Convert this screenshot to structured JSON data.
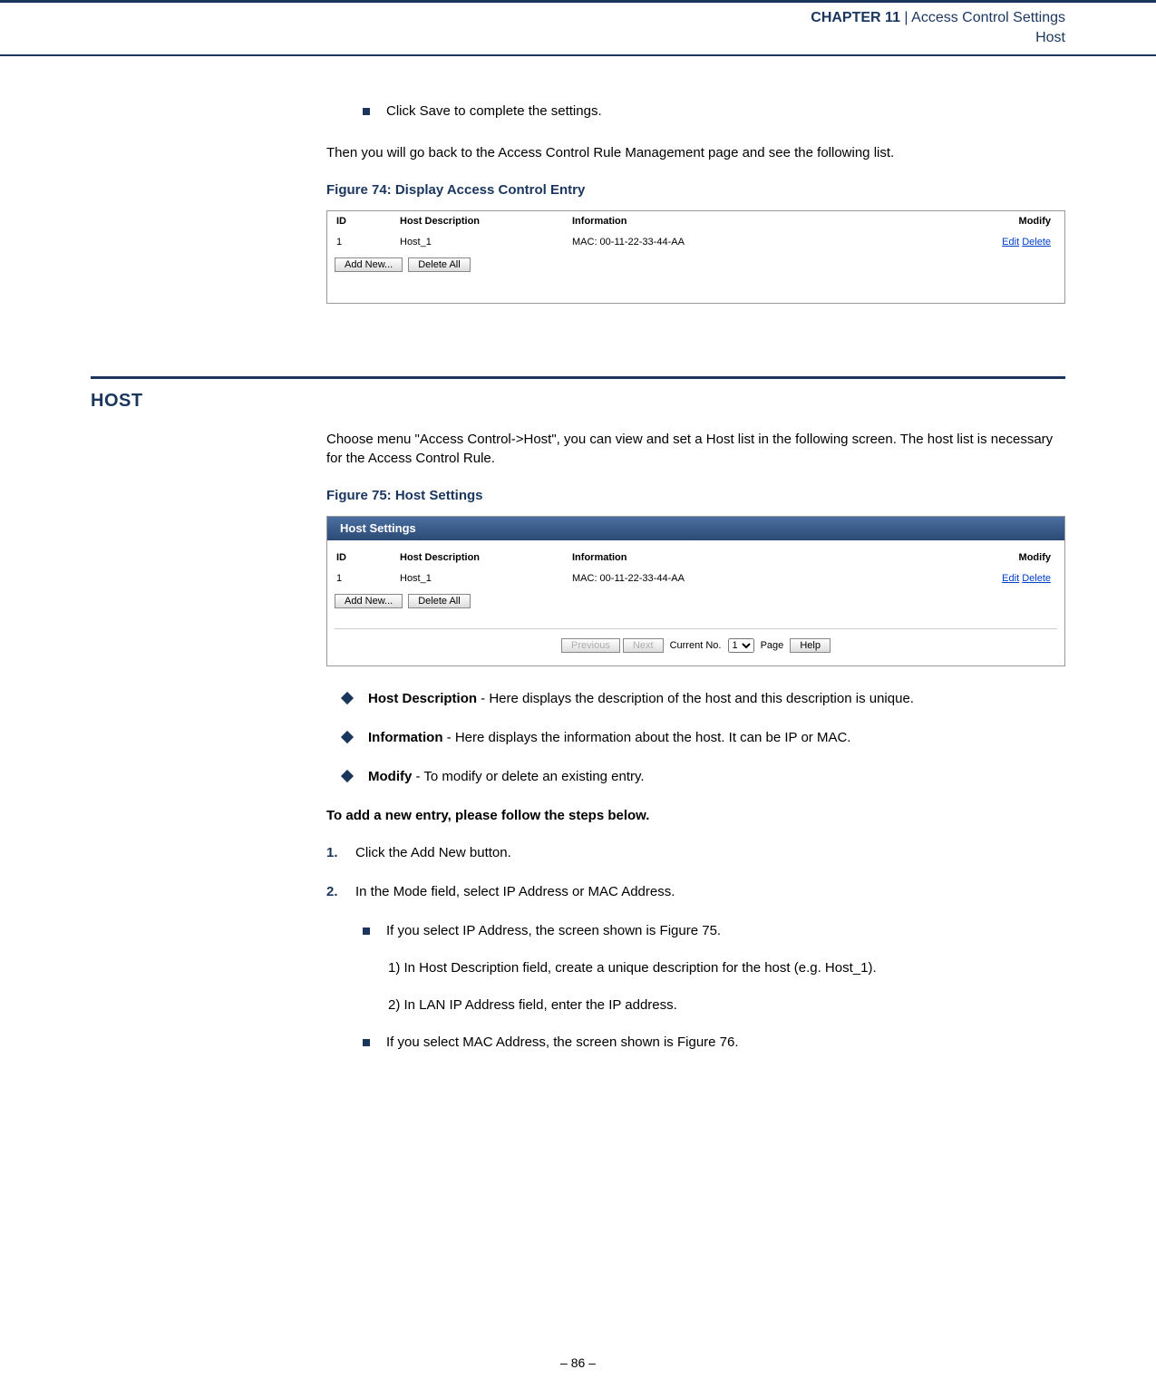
{
  "header": {
    "chapter_label": "CHAPTER 11",
    "separator": "  |  ",
    "title": "Access Control Settings",
    "subtitle": "Host"
  },
  "intro_bullet": "Click Save to complete the settings.",
  "intro_para": "Then you will go back to the Access Control Rule Management page and see the following list.",
  "fig74_caption": "Figure 74:  Display Access Control Entry",
  "fig74": {
    "cols": {
      "id": "ID",
      "desc": "Host Description",
      "info": "Information",
      "modify": "Modify"
    },
    "row": {
      "id": "1",
      "desc": "Host_1",
      "info": "MAC: 00-11-22-33-44-AA",
      "edit": "Edit",
      "delete": "Delete"
    },
    "btn_add": "Add New...",
    "btn_delall": "Delete All"
  },
  "section_heading": "HOST",
  "host_para": "Choose menu \"Access Control->Host\", you can view and set a Host list in the following screen. The host list is necessary for the Access Control Rule.",
  "fig75_caption": "Figure 75:  Host Settings",
  "fig75": {
    "title": "Host Settings",
    "cols": {
      "id": "ID",
      "desc": "Host Description",
      "info": "Information",
      "modify": "Modify"
    },
    "row": {
      "id": "1",
      "desc": "Host_1",
      "info": "MAC: 00-11-22-33-44-AA",
      "edit": "Edit",
      "delete": "Delete"
    },
    "btn_add": "Add New...",
    "btn_delall": "Delete All",
    "pager": {
      "prev": "Previous",
      "next": "Next",
      "current_label": "Current No.",
      "current_value": "1",
      "page_label": "Page",
      "help": "Help"
    }
  },
  "desc_items": [
    {
      "term": "Host Description",
      "text": " - Here displays the description of the host and this description is unique."
    },
    {
      "term": "Information",
      "text": " - Here displays the information about the host. It can be IP or MAC."
    },
    {
      "term": "Modify",
      "text": " - To modify or delete an existing entry."
    }
  ],
  "steps_heading": "To add a new entry, please follow the steps below.",
  "steps": {
    "s1_num": "1.",
    "s1_text": "Click the Add New button.",
    "s2_num": "2.",
    "s2_text": "In the Mode field, select IP Address or MAC Address.",
    "s2_sub1": "If you select IP Address, the screen shown is Figure 75.",
    "s2_sub1a": "1) In Host Description field, create a unique description for the host (e.g. Host_1).",
    "s2_sub1b": "2) In LAN IP Address field, enter the IP address.",
    "s2_sub2": "If you select MAC Address, the screen shown is Figure 76."
  },
  "footer": "–  86  –"
}
